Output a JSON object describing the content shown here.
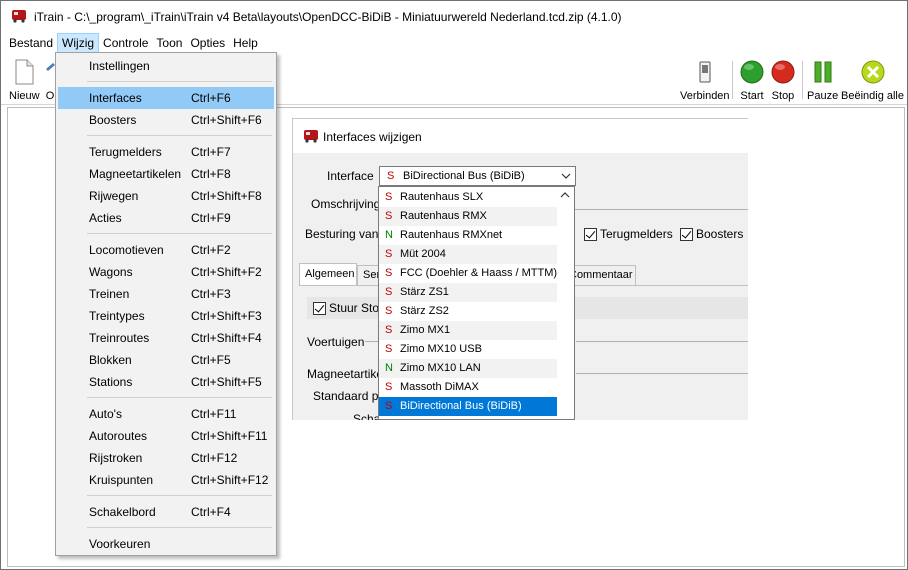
{
  "window": {
    "title": "iTrain - C:\\_program\\_iTrain\\iTrain v4 Beta\\layouts\\OpenDCC-BiDiB - Miniatuurwereld Nederland.tcd.zip (4.1.0)"
  },
  "menubar": {
    "items": [
      "Bestand",
      "Wijzig",
      "Controle",
      "Toon",
      "Opties",
      "Help"
    ],
    "active": "Wijzig"
  },
  "toolbar": {
    "left": [
      {
        "label": "Nieuw",
        "icon": "new-document-icon"
      },
      {
        "label": "O",
        "icon": "open-icon"
      }
    ],
    "right": [
      {
        "label": "Verbinden",
        "icon": "connect-switch-icon"
      },
      {
        "label": "Start",
        "icon": "green-circle-icon"
      },
      {
        "label": "Stop",
        "icon": "red-circle-icon"
      },
      {
        "label": "Pauze",
        "icon": "pause-icon"
      },
      {
        "label": "Beëindig alle",
        "icon": "cancel-all-icon"
      }
    ],
    "colors": {
      "start": "#2e9e2e",
      "stop": "#d62a1f",
      "pause": "#4caf28",
      "cancel": "#b6d91e"
    }
  },
  "wijzig_menu": {
    "groups": [
      [
        {
          "label": "Instellingen",
          "shortcut": ""
        }
      ],
      [
        {
          "label": "Interfaces",
          "shortcut": "Ctrl+F6",
          "highlighted": true
        },
        {
          "label": "Boosters",
          "shortcut": "Ctrl+Shift+F6"
        }
      ],
      [
        {
          "label": "Terugmelders",
          "shortcut": "Ctrl+F7"
        },
        {
          "label": "Magneetartikelen",
          "shortcut": "Ctrl+F8"
        },
        {
          "label": "Rijwegen",
          "shortcut": "Ctrl+Shift+F8"
        },
        {
          "label": "Acties",
          "shortcut": "Ctrl+F9"
        }
      ],
      [
        {
          "label": "Locomotieven",
          "shortcut": "Ctrl+F2"
        },
        {
          "label": "Wagons",
          "shortcut": "Ctrl+Shift+F2"
        },
        {
          "label": "Treinen",
          "shortcut": "Ctrl+F3"
        },
        {
          "label": "Treintypes",
          "shortcut": "Ctrl+Shift+F3"
        },
        {
          "label": "Treinroutes",
          "shortcut": "Ctrl+Shift+F4"
        },
        {
          "label": "Blokken",
          "shortcut": "Ctrl+F5"
        },
        {
          "label": "Stations",
          "shortcut": "Ctrl+Shift+F5"
        }
      ],
      [
        {
          "label": "Auto's",
          "shortcut": "Ctrl+F11"
        },
        {
          "label": "Autoroutes",
          "shortcut": "Ctrl+Shift+F11"
        },
        {
          "label": "Rijstroken",
          "shortcut": "Ctrl+F12"
        },
        {
          "label": "Kruispunten",
          "shortcut": "Ctrl+Shift+F12"
        }
      ],
      [
        {
          "label": "Schakelbord",
          "shortcut": "Ctrl+F4"
        }
      ],
      [
        {
          "label": "Voorkeuren",
          "shortcut": ""
        }
      ]
    ]
  },
  "dialog": {
    "title": "Interfaces wijzigen",
    "interface_label": "Interface",
    "selected_letter": "S",
    "selected_value": "BiDirectional Bus (BiDiB)",
    "omschrijving_label": "Omschrijving",
    "besturing_label": "Besturing van",
    "checkbox_terugmelders": "Terugmelders",
    "checkbox_boosters": "Boosters",
    "tabs": [
      "Algemeen",
      "Ser",
      "Commentaar"
    ],
    "stuur_stop": "Stuur Stop",
    "voertuigen_label": "Voertuigen",
    "magneetartikel_label": "Magneetartikel",
    "standaard_label": "Standaard pr",
    "schak_label": "Schak"
  },
  "dropdown": {
    "items": [
      {
        "letter": "S",
        "name": "Rautenhaus SLX",
        "color": "red"
      },
      {
        "letter": "S",
        "name": "Rautenhaus RMX",
        "color": "red"
      },
      {
        "letter": "N",
        "name": "Rautenhaus RMXnet",
        "color": "green"
      },
      {
        "letter": "S",
        "name": "Müt 2004",
        "color": "red"
      },
      {
        "letter": "S",
        "name": "FCC (Doehler & Haass / MTTM)",
        "color": "red"
      },
      {
        "letter": "S",
        "name": "Stärz ZS1",
        "color": "red"
      },
      {
        "letter": "S",
        "name": "Stärz ZS2",
        "color": "red"
      },
      {
        "letter": "S",
        "name": "Zimo MX1",
        "color": "red"
      },
      {
        "letter": "S",
        "name": "Zimo MX10 USB",
        "color": "red"
      },
      {
        "letter": "N",
        "name": "Zimo MX10 LAN",
        "color": "green"
      },
      {
        "letter": "S",
        "name": "Massoth DiMAX",
        "color": "red"
      },
      {
        "letter": "S",
        "name": "BiDirectional Bus (BiDiB)",
        "color": "red",
        "selected": true
      }
    ]
  }
}
